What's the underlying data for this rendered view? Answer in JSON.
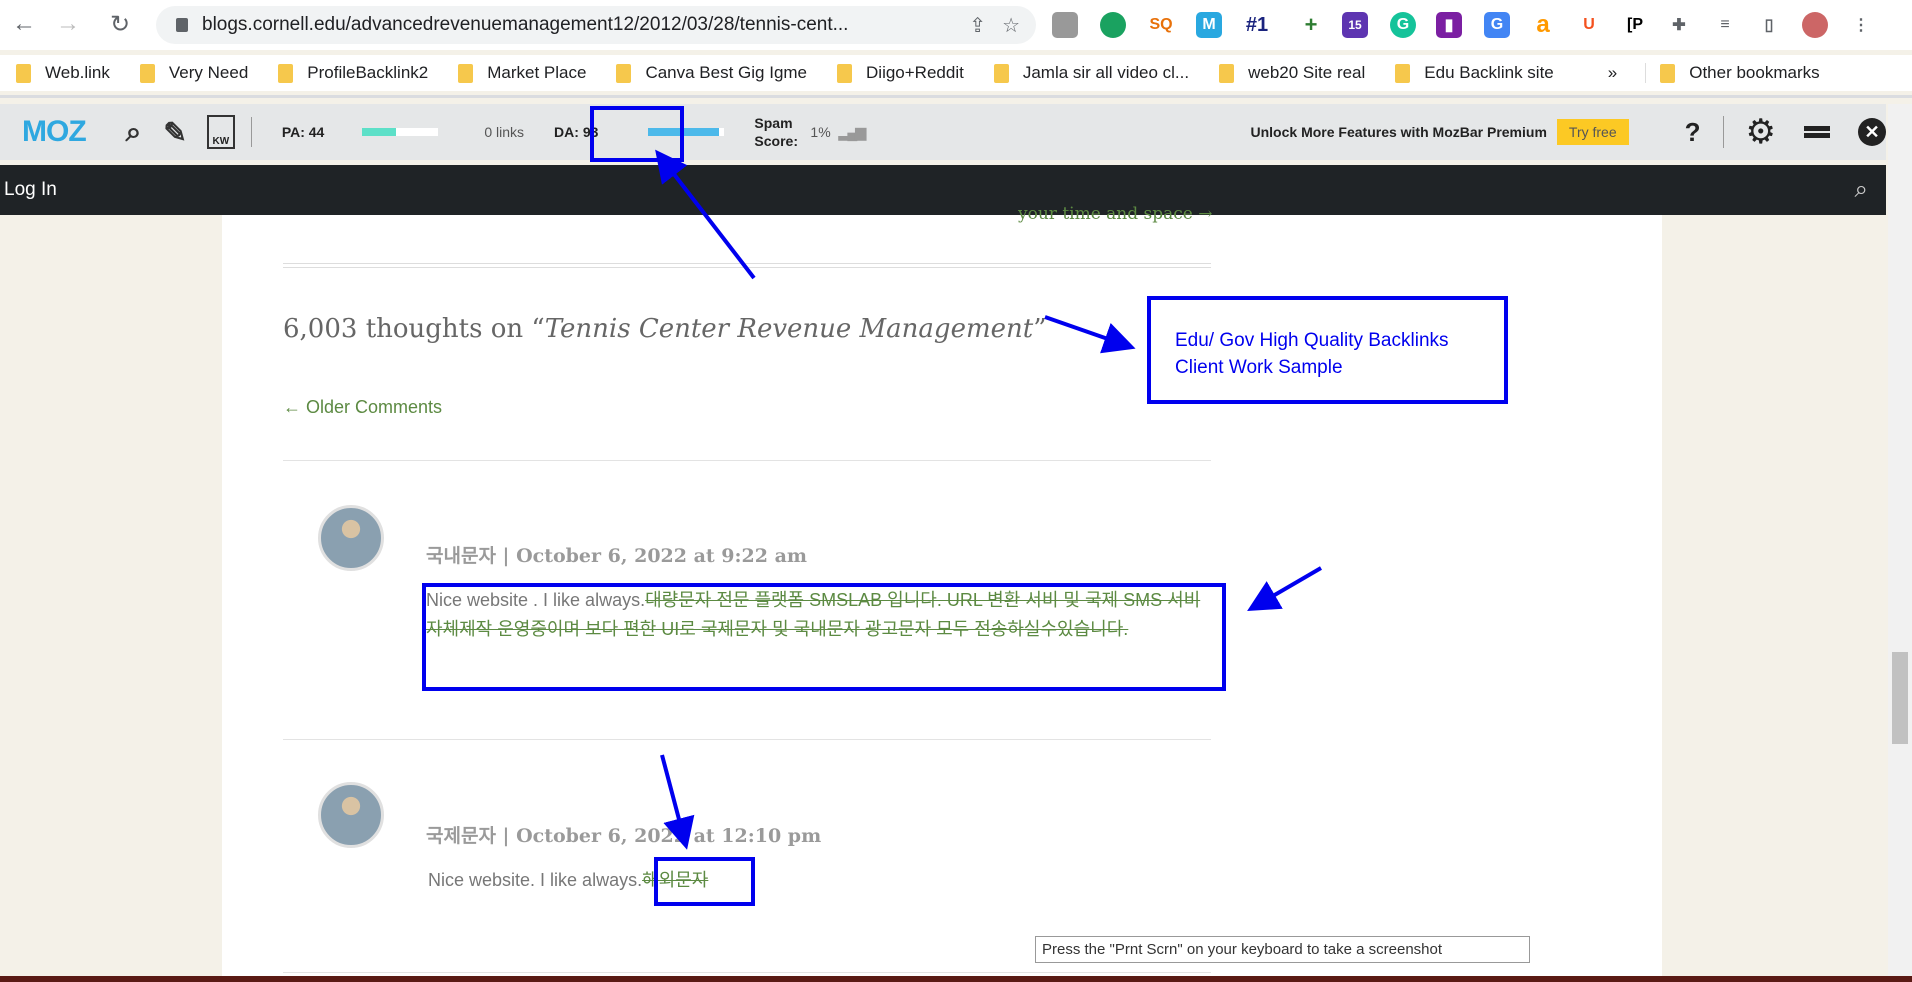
{
  "browser": {
    "url": "blogs.cornell.edu/advancedrevenuemanagement12/2012/03/28/tennis-cent...",
    "extensions": [
      "#1",
      "15"
    ],
    "bookmarks": [
      "Web.link",
      "Very Need",
      "ProfileBacklink2",
      "Market Place",
      "Canva Best Gig Igme",
      "Diigo+Reddit",
      "Jamla sir all video cl...",
      "web20 Site real",
      "Edu Backlink site"
    ],
    "more": "»",
    "other": "Other bookmarks"
  },
  "mozbar": {
    "logo": "MOZ",
    "pa": "PA: 44",
    "links": "0 links",
    "da": "DA: 93",
    "spam_label": "Spam Score:",
    "spam_value": "1%",
    "promo": "Unlock More Features with MozBar Premium",
    "try": "Try free",
    "help": "?",
    "pa_fill": 0.44,
    "da_fill": 0.93
  },
  "site": {
    "login": "Log In",
    "prev_link": "your time and space →",
    "comments_title_prefix": "6,003 thoughts on “",
    "comments_title_post": "Tennis Center Revenue Management",
    "comments_title_suffix": "”",
    "older": "← Older Comments",
    "comments": [
      {
        "author": "국내문자",
        "date": "October 6, 2022 at 9:22 am",
        "text": "Nice website . I like always.",
        "link": "대량문자 전문 플랫폼 SMSLAB 입니다. URL 변환 서비 및 국제 SMS 서비 자체제작 운영중이며 보다 편한 UI로 국제문자 및 국내문자 광고문자 모두 전송하실수있습니다."
      },
      {
        "author": "국제문자",
        "date": "October 6, 2022 at 12:10 pm",
        "text": "Nice website. I like always.",
        "link": "해외문자"
      }
    ]
  },
  "annotation": {
    "line1": "Edu/ Gov High Quality Backlinks",
    "line2": "Client Work Sample",
    "color": "#0000ee"
  },
  "tooltip": "Press the \"Prnt Scrn\" on your keyboard to take a screenshot"
}
